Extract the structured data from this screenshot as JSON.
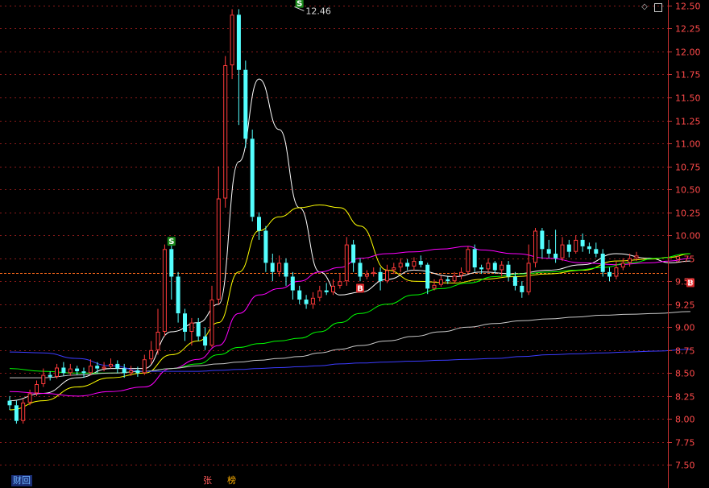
{
  "chart_data": {
    "type": "candlestick",
    "ylim": [
      7.25,
      12.56
    ],
    "y_ticks": [
      "12.50",
      "12.25",
      "12.00",
      "11.75",
      "11.50",
      "11.25",
      "11.00",
      "10.75",
      "10.50",
      "10.25",
      "10.00",
      "9.75",
      "9.50",
      "9.25",
      "9.00",
      "8.75",
      "8.50",
      "8.25",
      "8.00",
      "7.75",
      "7.50"
    ],
    "current_price": 9.59,
    "annotations": [
      {
        "label": "12.46",
        "bar": 42,
        "price": 12.46
      }
    ],
    "signals": [
      {
        "label": "S",
        "bar": 24,
        "price": 9.93,
        "type": "sell"
      },
      {
        "label": "S",
        "bar": 43,
        "price": 12.52,
        "type": "sell"
      },
      {
        "label": "B",
        "bar": 52,
        "price": 9.42,
        "type": "buy"
      },
      {
        "label": "B",
        "bar": 101,
        "price": 9.48,
        "type": "buy"
      }
    ],
    "candles": [
      [
        8.2,
        8.15,
        8.25,
        8.1
      ],
      [
        8.15,
        7.98,
        8.2,
        7.95
      ],
      [
        7.98,
        8.18,
        8.22,
        7.95
      ],
      [
        8.18,
        8.28,
        8.32,
        8.15
      ],
      [
        8.28,
        8.38,
        8.42,
        8.25
      ],
      [
        8.38,
        8.48,
        8.55,
        8.35
      ],
      [
        8.48,
        8.46,
        8.52,
        8.42
      ],
      [
        8.46,
        8.56,
        8.6,
        8.44
      ],
      [
        8.56,
        8.5,
        8.62,
        8.47
      ],
      [
        8.5,
        8.55,
        8.6,
        8.47
      ],
      [
        8.55,
        8.52,
        8.58,
        8.48
      ],
      [
        8.52,
        8.5,
        8.56,
        8.45
      ],
      [
        8.5,
        8.58,
        8.65,
        8.48
      ],
      [
        8.58,
        8.55,
        8.62,
        8.5
      ],
      [
        8.55,
        8.57,
        8.62,
        8.52
      ],
      [
        8.57,
        8.6,
        8.66,
        8.55
      ],
      [
        8.6,
        8.55,
        8.64,
        8.5
      ],
      [
        8.55,
        8.5,
        8.6,
        8.45
      ],
      [
        8.5,
        8.53,
        8.58,
        8.47
      ],
      [
        8.53,
        8.5,
        8.57,
        8.46
      ],
      [
        8.5,
        8.65,
        8.7,
        8.48
      ],
      [
        8.65,
        8.75,
        8.85,
        8.6
      ],
      [
        8.75,
        8.95,
        9.2,
        8.7
      ],
      [
        8.95,
        9.85,
        9.9,
        8.9
      ],
      [
        9.85,
        9.55,
        9.95,
        9.3
      ],
      [
        9.55,
        9.15,
        9.6,
        9.05
      ],
      [
        9.15,
        8.95,
        9.2,
        8.85
      ],
      [
        8.95,
        9.05,
        9.1,
        8.8
      ],
      [
        9.05,
        8.9,
        9.1,
        8.85
      ],
      [
        8.9,
        8.8,
        9.0,
        8.75
      ],
      [
        8.8,
        9.3,
        9.45,
        8.78
      ],
      [
        9.3,
        10.4,
        10.75,
        9.25
      ],
      [
        10.4,
        11.85,
        11.95,
        10.3
      ],
      [
        11.85,
        12.4,
        12.46,
        11.7
      ],
      [
        12.4,
        11.8,
        12.46,
        11.2
      ],
      [
        11.8,
        11.05,
        11.9,
        10.95
      ],
      [
        11.05,
        10.2,
        11.15,
        10.15
      ],
      [
        10.2,
        10.05,
        10.25,
        9.95
      ],
      [
        10.05,
        9.7,
        10.1,
        9.6
      ],
      [
        9.7,
        9.6,
        9.8,
        9.5
      ],
      [
        9.6,
        9.7,
        9.78,
        9.55
      ],
      [
        9.7,
        9.55,
        9.75,
        9.45
      ],
      [
        9.55,
        9.4,
        9.6,
        9.3
      ],
      [
        9.4,
        9.3,
        9.45,
        9.25
      ],
      [
        9.3,
        9.25,
        9.35,
        9.2
      ],
      [
        9.25,
        9.32,
        9.38,
        9.2
      ],
      [
        9.32,
        9.4,
        9.45,
        9.28
      ],
      [
        9.4,
        9.38,
        9.48,
        9.35
      ],
      [
        9.38,
        9.45,
        9.52,
        9.35
      ],
      [
        9.45,
        9.5,
        9.58,
        9.42
      ],
      [
        9.5,
        9.9,
        9.98,
        9.45
      ],
      [
        9.9,
        9.7,
        9.95,
        9.6
      ],
      [
        9.7,
        9.55,
        9.75,
        9.5
      ],
      [
        9.55,
        9.58,
        9.62,
        9.52
      ],
      [
        9.58,
        9.6,
        9.65,
        9.55
      ],
      [
        9.6,
        9.5,
        9.65,
        9.4
      ],
      [
        9.5,
        9.62,
        9.68,
        9.48
      ],
      [
        9.62,
        9.65,
        9.7,
        9.58
      ],
      [
        9.65,
        9.7,
        9.75,
        9.6
      ],
      [
        9.7,
        9.66,
        9.74,
        9.62
      ],
      [
        9.66,
        9.72,
        9.76,
        9.62
      ],
      [
        9.72,
        9.68,
        9.78,
        9.65
      ],
      [
        9.68,
        9.42,
        9.7,
        9.36
      ],
      [
        9.42,
        9.46,
        9.52,
        9.4
      ],
      [
        9.46,
        9.52,
        9.56,
        9.44
      ],
      [
        9.52,
        9.5,
        9.55,
        9.47
      ],
      [
        9.5,
        9.56,
        9.6,
        9.48
      ],
      [
        9.56,
        9.6,
        9.65,
        9.52
      ],
      [
        9.6,
        9.85,
        9.88,
        9.58
      ],
      [
        9.85,
        9.65,
        9.9,
        9.6
      ],
      [
        9.65,
        9.63,
        9.68,
        9.58
      ],
      [
        9.63,
        9.7,
        9.75,
        9.6
      ],
      [
        9.7,
        9.62,
        9.72,
        9.58
      ],
      [
        9.62,
        9.68,
        9.72,
        9.55
      ],
      [
        9.68,
        9.55,
        9.72,
        9.5
      ],
      [
        9.55,
        9.45,
        9.6,
        9.4
      ],
      [
        9.45,
        9.38,
        9.5,
        9.32
      ],
      [
        9.38,
        9.7,
        9.9,
        9.35
      ],
      [
        9.7,
        10.05,
        10.08,
        9.65
      ],
      [
        10.05,
        9.85,
        10.08,
        9.75
      ],
      [
        9.85,
        9.8,
        9.95,
        9.75
      ],
      [
        9.8,
        9.75,
        10.06,
        9.7
      ],
      [
        9.75,
        9.9,
        9.98,
        9.72
      ],
      [
        9.9,
        9.82,
        9.95,
        9.76
      ],
      [
        9.82,
        9.95,
        10.0,
        9.8
      ],
      [
        9.95,
        9.88,
        10.02,
        9.82
      ],
      [
        9.88,
        9.85,
        9.92,
        9.8
      ],
      [
        9.85,
        9.8,
        9.92,
        9.76
      ],
      [
        9.8,
        9.6,
        9.85,
        9.55
      ],
      [
        9.6,
        9.55,
        9.65,
        9.5
      ],
      [
        9.55,
        9.65,
        9.72,
        9.52
      ],
      [
        9.65,
        9.7,
        9.75,
        9.62
      ],
      [
        9.7,
        9.75,
        9.8,
        9.66
      ],
      [
        9.75,
        9.78,
        9.82,
        9.72
      ]
    ],
    "moving_averages": [
      {
        "color": "#ffffff",
        "values": [
          [
            0,
            8.2
          ],
          [
            5,
            8.28
          ],
          [
            10,
            8.45
          ],
          [
            15,
            8.55
          ],
          [
            20,
            8.55
          ],
          [
            24,
            8.95
          ],
          [
            28,
            9.05
          ],
          [
            31,
            9.25
          ],
          [
            34,
            10.8
          ],
          [
            37,
            11.7
          ],
          [
            40,
            11.15
          ],
          [
            43,
            10.3
          ],
          [
            46,
            9.6
          ],
          [
            49,
            9.35
          ],
          [
            52,
            9.38
          ],
          [
            56,
            9.52
          ],
          [
            60,
            9.62
          ],
          [
            66,
            9.55
          ],
          [
            70,
            9.6
          ],
          [
            75,
            9.58
          ],
          [
            80,
            9.62
          ],
          [
            85,
            9.68
          ],
          [
            90,
            9.8
          ],
          [
            95,
            9.75
          ],
          [
            98,
            9.7
          ],
          [
            101,
            9.72
          ]
        ]
      },
      {
        "color": "#ffff00",
        "values": [
          [
            0,
            8.1
          ],
          [
            5,
            8.2
          ],
          [
            10,
            8.35
          ],
          [
            15,
            8.45
          ],
          [
            20,
            8.5
          ],
          [
            24,
            8.7
          ],
          [
            28,
            8.85
          ],
          [
            31,
            9.05
          ],
          [
            34,
            9.6
          ],
          [
            37,
            10.05
          ],
          [
            40,
            10.2
          ],
          [
            43,
            10.3
          ],
          [
            46,
            10.33
          ],
          [
            49,
            10.3
          ],
          [
            52,
            10.1
          ],
          [
            56,
            9.62
          ],
          [
            60,
            9.5
          ],
          [
            66,
            9.48
          ],
          [
            70,
            9.52
          ],
          [
            75,
            9.55
          ],
          [
            80,
            9.58
          ],
          [
            85,
            9.62
          ],
          [
            90,
            9.72
          ],
          [
            95,
            9.74
          ],
          [
            98,
            9.76
          ],
          [
            101,
            9.8
          ]
        ]
      },
      {
        "color": "#ff00ff",
        "values": [
          [
            0,
            8.3
          ],
          [
            5,
            8.28
          ],
          [
            10,
            8.25
          ],
          [
            15,
            8.3
          ],
          [
            20,
            8.35
          ],
          [
            24,
            8.55
          ],
          [
            28,
            8.65
          ],
          [
            31,
            8.8
          ],
          [
            34,
            9.15
          ],
          [
            37,
            9.35
          ],
          [
            40,
            9.42
          ],
          [
            43,
            9.5
          ],
          [
            46,
            9.6
          ],
          [
            49,
            9.65
          ],
          [
            52,
            9.75
          ],
          [
            56,
            9.8
          ],
          [
            60,
            9.82
          ],
          [
            64,
            9.85
          ],
          [
            68,
            9.88
          ],
          [
            70,
            9.84
          ],
          [
            75,
            9.8
          ],
          [
            80,
            9.75
          ],
          [
            85,
            9.7
          ],
          [
            90,
            9.68
          ],
          [
            95,
            9.7
          ],
          [
            98,
            9.72
          ],
          [
            101,
            9.75
          ]
        ]
      },
      {
        "color": "#00ff00",
        "values": [
          [
            0,
            8.55
          ],
          [
            5,
            8.52
          ],
          [
            10,
            8.5
          ],
          [
            15,
            8.5
          ],
          [
            20,
            8.52
          ],
          [
            24,
            8.55
          ],
          [
            28,
            8.6
          ],
          [
            31,
            8.7
          ],
          [
            34,
            8.78
          ],
          [
            37,
            8.82
          ],
          [
            40,
            8.85
          ],
          [
            43,
            8.88
          ],
          [
            46,
            8.95
          ],
          [
            49,
            9.05
          ],
          [
            52,
            9.15
          ],
          [
            56,
            9.25
          ],
          [
            60,
            9.35
          ],
          [
            64,
            9.42
          ],
          [
            68,
            9.48
          ],
          [
            72,
            9.55
          ],
          [
            76,
            9.58
          ],
          [
            80,
            9.6
          ],
          [
            84,
            9.62
          ],
          [
            88,
            9.65
          ],
          [
            92,
            9.7
          ],
          [
            96,
            9.75
          ],
          [
            101,
            9.8
          ]
        ]
      },
      {
        "color": "#c8c8c8",
        "values": [
          [
            0,
            8.45
          ],
          [
            5,
            8.45
          ],
          [
            10,
            8.48
          ],
          [
            15,
            8.5
          ],
          [
            20,
            8.52
          ],
          [
            24,
            8.55
          ],
          [
            28,
            8.58
          ],
          [
            31,
            8.6
          ],
          [
            34,
            8.62
          ],
          [
            37,
            8.64
          ],
          [
            40,
            8.66
          ],
          [
            43,
            8.68
          ],
          [
            46,
            8.72
          ],
          [
            49,
            8.76
          ],
          [
            52,
            8.8
          ],
          [
            56,
            8.85
          ],
          [
            60,
            8.9
          ],
          [
            64,
            8.95
          ],
          [
            68,
            9.0
          ],
          [
            72,
            9.04
          ],
          [
            76,
            9.07
          ],
          [
            80,
            9.09
          ],
          [
            84,
            9.11
          ],
          [
            88,
            9.13
          ],
          [
            92,
            9.14
          ],
          [
            96,
            9.15
          ],
          [
            101,
            9.17
          ]
        ]
      },
      {
        "color": "#3c3cff",
        "values": [
          [
            0,
            8.73
          ],
          [
            5,
            8.72
          ],
          [
            10,
            8.66
          ],
          [
            15,
            8.58
          ],
          [
            20,
            8.52
          ],
          [
            24,
            8.52
          ],
          [
            28,
            8.52
          ],
          [
            31,
            8.53
          ],
          [
            34,
            8.54
          ],
          [
            37,
            8.55
          ],
          [
            40,
            8.56
          ],
          [
            43,
            8.57
          ],
          [
            46,
            8.58
          ],
          [
            49,
            8.6
          ],
          [
            52,
            8.61
          ],
          [
            56,
            8.62
          ],
          [
            60,
            8.63
          ],
          [
            64,
            8.64
          ],
          [
            68,
            8.65
          ],
          [
            72,
            8.66
          ],
          [
            76,
            8.68
          ],
          [
            80,
            8.7
          ],
          [
            84,
            8.71
          ],
          [
            88,
            8.72
          ],
          [
            92,
            8.73
          ],
          [
            96,
            8.74
          ],
          [
            101,
            8.76
          ]
        ]
      }
    ]
  },
  "footer": {
    "caiwu": "财回",
    "zhang": "张",
    "bang": "榜"
  },
  "toolbar": {
    "diamond_icon": "diamond-icon",
    "panel_icon": "panel-icon"
  }
}
